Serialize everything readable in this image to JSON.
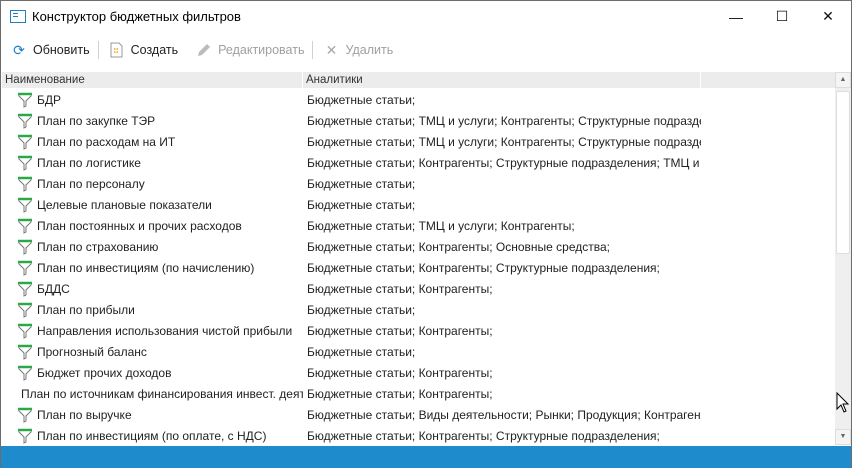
{
  "window": {
    "title": "Конструктор бюджетных фильтров",
    "controls": {
      "minimize": "—",
      "maximize": "☐",
      "close": "✕"
    }
  },
  "toolbar": {
    "refresh": "Обновить",
    "create": "Создать",
    "edit": "Редактировать",
    "delete": "Удалить"
  },
  "table": {
    "columns": [
      "Наименование",
      "Аналитики"
    ],
    "rows": [
      {
        "name": "БДР",
        "analytics": "Бюджетные статьи;"
      },
      {
        "name": "План по закупке ТЭР",
        "analytics": "Бюджетные статьи; ТМЦ и услуги; Контрагенты; Структурные подразделения;"
      },
      {
        "name": "План по расходам на ИТ",
        "analytics": "Бюджетные статьи; ТМЦ и услуги; Контрагенты; Структурные подразделения;"
      },
      {
        "name": "План по логистике",
        "analytics": "Бюджетные статьи; Контрагенты; Структурные подразделения; ТМЦ и услуги;"
      },
      {
        "name": "План по персоналу",
        "analytics": "Бюджетные статьи;"
      },
      {
        "name": "Целевые плановые показатели",
        "analytics": "Бюджетные статьи;"
      },
      {
        "name": "План постоянных и прочих расходов",
        "analytics": "Бюджетные статьи; ТМЦ и услуги; Контрагенты;"
      },
      {
        "name": "План по страхованию",
        "analytics": "Бюджетные статьи; Контрагенты; Основные средства;"
      },
      {
        "name": "План по инвестициям (по начислению)",
        "analytics": "Бюджетные статьи; Контрагенты; Структурные подразделения;"
      },
      {
        "name": "БДДС",
        "analytics": "Бюджетные статьи; Контрагенты;"
      },
      {
        "name": "План по прибыли",
        "analytics": "Бюджетные статьи;"
      },
      {
        "name": "Направления использования чистой прибыли",
        "analytics": "Бюджетные статьи; Контрагенты;"
      },
      {
        "name": "Прогнозный баланс",
        "analytics": "Бюджетные статьи;"
      },
      {
        "name": "Бюджет прочих доходов",
        "analytics": "Бюджетные статьи; Контрагенты;"
      },
      {
        "name": "План по источникам финансирования инвест. деятельности",
        "analytics": "Бюджетные статьи; Контрагенты;"
      },
      {
        "name": "План по выручке",
        "analytics": "Бюджетные статьи; Виды деятельности; Рынки; Продукция; Контрагенты;"
      },
      {
        "name": "План по инвестициям (по оплате, с НДС)",
        "analytics": "Бюджетные статьи; Контрагенты; Структурные подразделения;"
      }
    ],
    "row_icon": "filter-funnel-icon"
  },
  "scroll_position": 0,
  "colors": {
    "accent": "#1e8ccc",
    "funnel_top": "#2aa84a"
  }
}
